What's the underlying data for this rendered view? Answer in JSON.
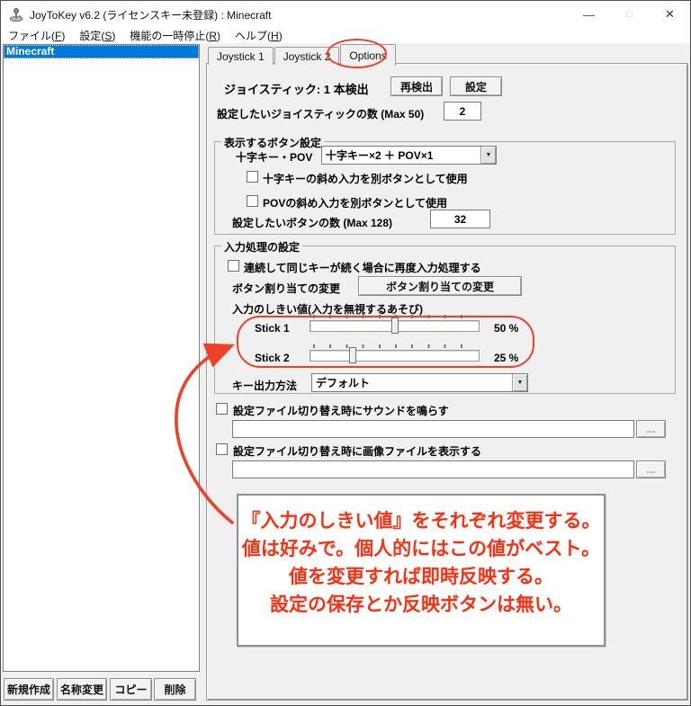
{
  "window": {
    "title": "JoyToKey v6.2 (ライセンスキー未登録) : Minecraft",
    "minimize_glyph": "—",
    "maximize_glyph": "□",
    "close_glyph": "✕"
  },
  "menu": {
    "items": [
      {
        "pre": "ファイル(",
        "key": "F",
        "post": ")"
      },
      {
        "pre": "設定(",
        "key": "S",
        "post": ")"
      },
      {
        "pre": "機能の一時停止(",
        "key": "R",
        "post": ")"
      },
      {
        "pre": "ヘルプ(",
        "key": "H",
        "post": ")"
      }
    ]
  },
  "sidebar": {
    "selected_profile": "Minecraft"
  },
  "tabs": [
    {
      "label": "Joystick 1",
      "active": false
    },
    {
      "label": "Joystick 2",
      "active": false
    },
    {
      "label": "Options",
      "active": true
    }
  ],
  "options_tab": {
    "joystick_detected_label": "ジョイスティック: 1 本検出",
    "redetect_button": "再検出",
    "settings_button": "設定",
    "joystick_count_label": "設定したいジョイスティックの数 (Max 50)",
    "joystick_count_value": "2",
    "button_display_group": {
      "title": "表示するボタン設定",
      "pov_label": "十字キー・POV",
      "pov_value": "十字キー×2 ＋ POV×1",
      "dropdown_arrow": "▼",
      "checkbox_dpad_diagonal": "十字キーの斜め入力を別ボタンとして使用",
      "checkbox_pov_diagonal": "POVの斜め入力を別ボタンとして使用",
      "button_count_label": "設定したいボタンの数 (Max 128)",
      "button_count_value": "32"
    },
    "input_processing_group": {
      "title": "入力処理の設定",
      "checkbox_repeat": "連続して同じキーが続く場合に再度入力処理する",
      "assign_label": "ボタン割り当ての変更",
      "assign_button": "ボタン割り当ての変更",
      "threshold_label": "入力のしきい値(入力を無視するあそび)",
      "sliders": [
        {
          "label": "Stick 1",
          "percent": 50,
          "display": "50 %"
        },
        {
          "label": "Stick 2",
          "percent": 25,
          "display": "25 %"
        }
      ],
      "key_output_label": "キー出力方法",
      "key_output_value": "デフォルト",
      "dropdown_arrow": "▼"
    },
    "checkbox_sound": "設定ファイル切り替え時にサウンドを鳴らす",
    "sound_path_value": "",
    "browse_button": "...",
    "checkbox_image": "設定ファイル切り替え時に画像ファイルを表示する",
    "image_path_value": ""
  },
  "annotation": {
    "lines": [
      "『入力のしきい値』をそれぞれ変更する。",
      "値は好みで。個人的にはこの値がベスト。",
      "",
      "値を変更すれば即時反映する。",
      "設定の保存とか反映ボタンは無い。"
    ]
  },
  "footer_buttons": {
    "new": "新規作成",
    "rename": "名称変更",
    "copy": "コピー",
    "delete": "削除"
  },
  "colors": {
    "selection_blue": "#0078d7",
    "annotation_text_red": "#fe2f10",
    "annotation_shape_red": "#f04028",
    "titlebar_bg": "#ffffff",
    "dialog_bg": "#f0f0f0"
  }
}
